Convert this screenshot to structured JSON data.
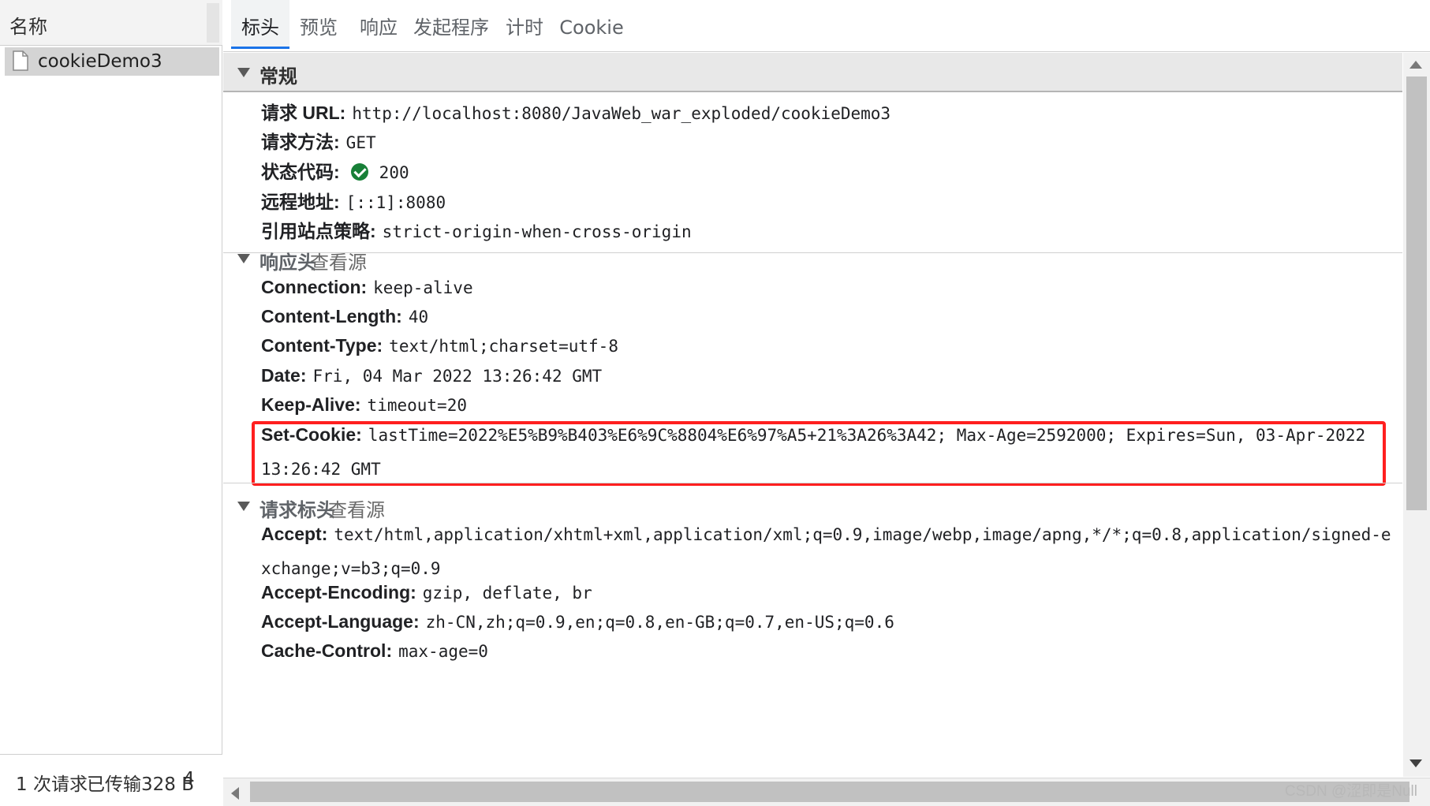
{
  "request_list": {
    "header": "名称",
    "items": [
      {
        "name": "cookieDemo3",
        "icon": "document-icon"
      }
    ],
    "footer": {
      "requests": "1 次请求",
      "transferred": "已传输328 B",
      "truncated": "4"
    }
  },
  "tabs": [
    {
      "label": "标头",
      "active": true
    },
    {
      "label": "预览",
      "active": false
    },
    {
      "label": "响应",
      "active": false
    },
    {
      "label": "发起程序",
      "active": false
    },
    {
      "label": "计时",
      "active": false
    },
    {
      "label": "Cookie",
      "active": false
    }
  ],
  "general": {
    "title": "常规",
    "rows": [
      {
        "key": "请求 URL:",
        "value": "http://localhost:8080/JavaWeb_war_exploded/cookieDemo3"
      },
      {
        "key": "请求方法:",
        "value": "GET"
      },
      {
        "key": "状态代码:",
        "value": "200",
        "status_color": "#188038"
      },
      {
        "key": "远程地址:",
        "value": "[::1]:8080"
      },
      {
        "key": "引用站点策略:",
        "value": "strict-origin-when-cross-origin"
      }
    ]
  },
  "response_headers": {
    "title": "响应头",
    "view_source": "查看源",
    "rows": [
      {
        "key": "Connection:",
        "value": "keep-alive"
      },
      {
        "key": "Content-Length:",
        "value": "40"
      },
      {
        "key": "Content-Type:",
        "value": "text/html;charset=utf-8"
      },
      {
        "key": "Date:",
        "value": "Fri, 04 Mar 2022 13:26:42 GMT"
      },
      {
        "key": "Keep-Alive:",
        "value": "timeout=20"
      },
      {
        "key": "Set-Cookie:",
        "value": "lastTime=2022%E5%B9%B403%E6%9C%8804%E6%97%A5+21%3A26%3A42; Max-Age=2592000; Expires=Sun, 03-Apr-2022 13:26:42 GMT",
        "highlighted": true,
        "highlight_color": "#ff1f1f"
      }
    ]
  },
  "request_headers": {
    "title": "请求标头",
    "view_source": "查看源",
    "rows": [
      {
        "key": "Accept:",
        "value": "text/html,application/xhtml+xml,application/xml;q=0.9,image/webp,image/apng,*/*;q=0.8,application/signed-exchange;v=b3;q=0.9"
      },
      {
        "key": "Accept-Encoding:",
        "value": "gzip, deflate, br"
      },
      {
        "key": "Accept-Language:",
        "value": "zh-CN,zh;q=0.9,en;q=0.8,en-GB;q=0.7,en-US;q=0.6"
      },
      {
        "key": "Cache-Control:",
        "value": "max-age=0"
      }
    ]
  },
  "watermark": "CSDN @涩即是Null",
  "colors": {
    "accent": "#1a73e8",
    "highlight": "#ff1f1f",
    "status_ok": "#188038"
  }
}
